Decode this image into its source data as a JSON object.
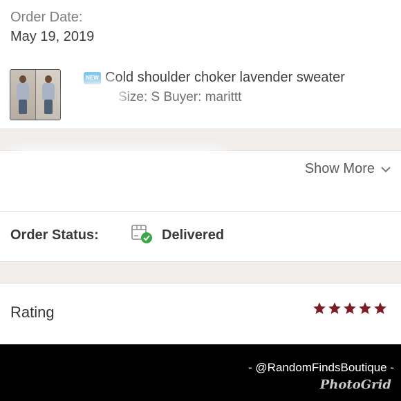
{
  "order": {
    "date_label": "Order Date:",
    "date_value": "May 19, 2019"
  },
  "item": {
    "badge": "NEW",
    "title": "Cold shoulder choker lavender sweater",
    "meta": "Size: S  Buyer: marittt",
    "thumbnail": "sweater-photo"
  },
  "details": {
    "show_more": "Show More",
    "show_more_icon": "chevron-down-icon"
  },
  "status": {
    "label": "Order Status:",
    "value": "Delivered",
    "icon": "delivered-box-check-icon",
    "check_color": "#3aa845"
  },
  "rating": {
    "label": "Rating",
    "stars": 5,
    "max_stars": 5,
    "star_color": "#7e1c25"
  },
  "footer": {
    "handle": "- @RandomFindsBoutique -",
    "app": "PhotoGrid"
  },
  "colors": {
    "divider_band": "#f1eeec",
    "footer_bg": "#000000"
  }
}
